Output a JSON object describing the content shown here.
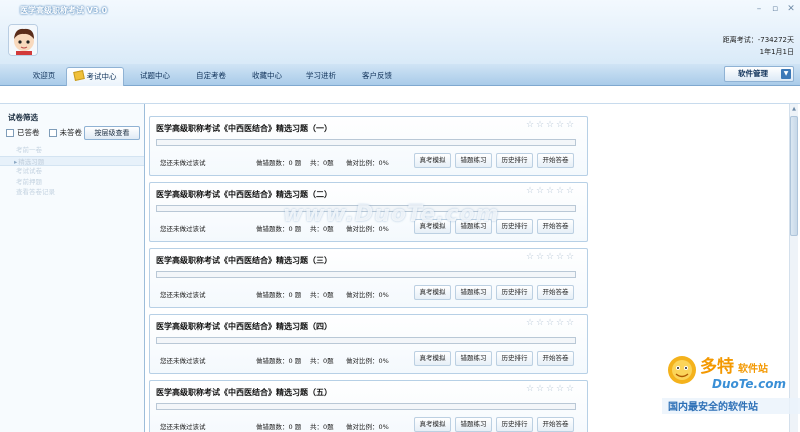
{
  "app": {
    "title": "医学高级职称考试 V3.0",
    "exam_distance_line1": "距离考试：-734272天",
    "exam_distance_line2": "1年1月1日"
  },
  "window": {
    "minimize": "–",
    "restore": "▫",
    "close": "✕"
  },
  "nav": {
    "tabs": [
      {
        "label": "欢迎页"
      },
      {
        "label": "考试中心"
      },
      {
        "label": "试题中心"
      },
      {
        "label": "自定考卷"
      },
      {
        "label": "收藏中心"
      },
      {
        "label": "学习进析"
      },
      {
        "label": "客户反馈"
      }
    ],
    "active_tab": "考试中心",
    "software_mgmt": "软件管理"
  },
  "sidebar": {
    "filter_title": "试卷筛选",
    "answered_label": "已答卷",
    "unanswered_label": "未答卷",
    "hierarchy_button": "按层级查看",
    "items": [
      {
        "label": "考前一卷"
      },
      {
        "label": "精选习题"
      },
      {
        "label": "考试试卷"
      },
      {
        "label": "考前押题"
      },
      {
        "label": "查看答卷记录"
      }
    ],
    "selected_index": 1
  },
  "cards": [
    {
      "title": "医学高级职称考试《中西医结合》精选习题（一）",
      "status": "您还未做过该试",
      "wrong_count": "做错题数：0 题",
      "total": "共：0题",
      "ratio": "做对比例：0%",
      "progress": 0
    },
    {
      "title": "医学高级职称考试《中西医结合》精选习题（二）",
      "status": "您还未做过该试",
      "wrong_count": "做错题数：0 题",
      "total": "共：0题",
      "ratio": "做对比例：0%",
      "progress": 0
    },
    {
      "title": "医学高级职称考试《中西医结合》精选习题（三）",
      "status": "您还未做过该试",
      "wrong_count": "做错题数：0 题",
      "total": "共：0题",
      "ratio": "做对比例：0%",
      "progress": 0
    },
    {
      "title": "医学高级职称考试《中西医结合》精选习题（四）",
      "status": "您还未做过该试",
      "wrong_count": "做错题数：0 题",
      "total": "共：0题",
      "ratio": "做对比例：0%",
      "progress": 0
    },
    {
      "title": "医学高级职称考试《中西医结合》精选习题（五）",
      "status": "您还未做过该试",
      "wrong_count": "做错题数：0 题",
      "total": "共：0题",
      "ratio": "做对比例：0%",
      "progress": 0
    }
  ],
  "card_buttons": {
    "mock": "真考模拟",
    "wrong": "错题练习",
    "history": "历史排行",
    "start": "开始答卷"
  },
  "card_rating": {
    "filled": 0,
    "max": 5
  },
  "watermark": {
    "center": "www.DuoTe.com",
    "br_brand": "多特软件站",
    "br_url": "DuoTe.com",
    "br_slogan": "国内最安全的软件站"
  },
  "colors": {
    "accent": "#3b78b7",
    "nav": "#a9cbe9",
    "card_border": "#b7d0e6"
  }
}
